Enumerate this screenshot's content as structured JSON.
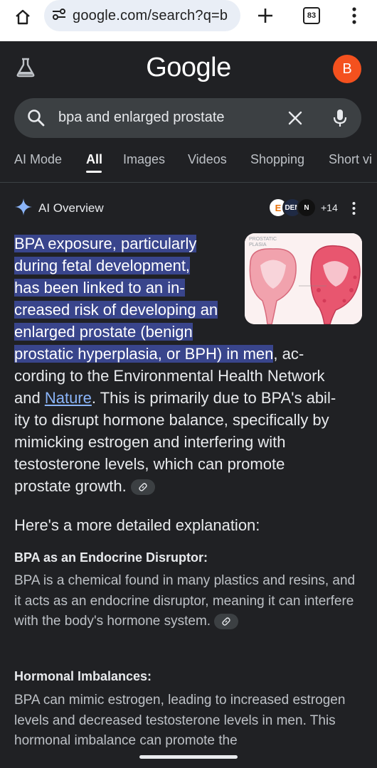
{
  "browser": {
    "url": "google.com/search?q=b",
    "tab_count": "83"
  },
  "header": {
    "logo": "Google",
    "avatar_letter": "B"
  },
  "search": {
    "query": "bpa and enlarged prostate"
  },
  "tabs": [
    {
      "label": "AI Mode"
    },
    {
      "label": "All",
      "active": true
    },
    {
      "label": "Images"
    },
    {
      "label": "Videos"
    },
    {
      "label": "Shopping"
    },
    {
      "label": "Short vi"
    }
  ],
  "ai_overview": {
    "title": "AI Overview",
    "sources_more": "+14",
    "source_icons": [
      "E",
      "DEN",
      "N"
    ],
    "image_caption_top": "PROSTATIC\nPLASIA",
    "lead_lines": [
      "BPA exposure, particularly",
      "during fetal development,",
      "has been linked to an in-",
      "creased risk of developing an",
      "enlarged prostate (benign",
      "prostatic hyperplasia, or BPH) in men"
    ],
    "lead_tail": ", ac-",
    "continuation_1": "cording to the Environmental Health Network",
    "continuation_2a": "and ",
    "link_text": "Nature",
    "continuation_2b": ". This is primarily due to BPA's abil-",
    "continuation_3": "ity to disrupt hormone balance, specifically by",
    "continuation_4": "mimicking estrogen and interfering with",
    "continuation_5": "testosterone levels, which can promote",
    "continuation_6": "prostate growth.",
    "section_heading": "Here's a more detailed explanation:",
    "sections": [
      {
        "title": "BPA as an Endocrine Disruptor:",
        "text": "BPA is a chemical found in many plastics and resins, and it acts as an endocrine disruptor, meaning it can interfere with the body's hormone system."
      },
      {
        "title": "Hormonal Imbalances:",
        "text": "BPA can mimic estrogen, leading to increased estrogen levels and decreased testosterone levels in men. This hormonal imbalance can promote the"
      }
    ]
  },
  "colors": {
    "background": "#202124",
    "highlight": "#39458c",
    "link": "#8ab4f8",
    "avatar": "#f4511e"
  }
}
